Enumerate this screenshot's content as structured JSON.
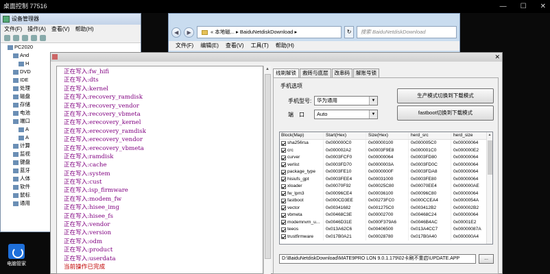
{
  "remote": {
    "title": "桌面控制 77516",
    "controls": [
      "—",
      "☐",
      "✕"
    ]
  },
  "desktop": {
    "icon_label": "电脑管家"
  },
  "devmgr": {
    "title": "设备管理器",
    "menu": [
      "文件(F)",
      "操作(A)",
      "查看(V)",
      "帮助(H)"
    ],
    "tree": [
      "PC2020",
      "And",
      "H",
      "DVD",
      "IDE",
      "处理",
      "磁盘",
      "存储",
      "电池",
      "端口",
      "计算",
      "监视",
      "键盘",
      "蓝牙",
      "人体",
      "软件",
      "鼠标",
      "通用"
    ]
  },
  "explorer": {
    "address": "« 本地磁...  ▸  BaiduNetdiskDownload  ▸",
    "search_placeholder": "搜索 BaiduNetdiskDownload",
    "menu": [
      "文件(F)",
      "编辑(E)",
      "查看(V)",
      "工具(T)",
      "帮助(H)"
    ]
  },
  "tool": {
    "log": [
      "正在写入:fw_hifi",
      "正在写入:dts",
      "正在写入:kernel",
      "正在写入:recovery_ramdisk",
      "正在写入:recovery_vendor",
      "正在写入:recovery_vbmeta",
      "正在写入:erecovery_kernel",
      "正在写入:erecovery_ramdisk",
      "正在写入:erecovery_vendor",
      "正在写入:erecovery_vbmeta",
      "正在写入:ramdisk",
      "正在写入:cache",
      "正在写入:system",
      "正在写入:cust",
      "正在写入:isp_firmware",
      "正在写入:modem_fw",
      "正在写入:hisee_img",
      "正在写入:hisee_fs",
      "正在写入:vendor",
      "正在写入:version",
      "正在写入:odm",
      "正在写入:product",
      "正在写入:userdata"
    ],
    "log_done": "当前操作已完成",
    "tabs": [
      "线刷解锁",
      "救砖与底层",
      "改串码",
      "解账号锁"
    ],
    "group_label": "手机选项",
    "model_label": "手机型号:",
    "model_value": "华为通用",
    "port_label": "端　口",
    "port_value": "Auto",
    "btn_prod": "生产模式切换到下载模式",
    "btn_fastboot": "fastboot切换到下载模式",
    "columns": [
      "Block(Map)",
      "Start(Hex)",
      "Size(Hex)",
      "herd_src",
      "herd_size"
    ],
    "rows": [
      [
        "sha256rsa",
        "0x000000C0",
        "0x00000100",
        "0x000005C0",
        "0x00000064"
      ],
      [
        "crc",
        "0x000002A2",
        "0x0003F9E8",
        "0x000001C0",
        "0x000000E2"
      ],
      [
        "curver",
        "0x0003FCF0",
        "0x00000064",
        "0x0003FD80",
        "0x00000064"
      ],
      [
        "verlist",
        "0x0003FD70",
        "0x0000003A",
        "0x0003FD0C",
        "0x00000064"
      ],
      [
        "package_type",
        "0x0003FE10",
        "0x0000000F",
        "0x0003FDA8",
        "0x00000064"
      ],
      [
        "hisiufs_gpt",
        "0x0003FEE4",
        "0x00031000",
        "0x0003FE80",
        "0x00000064"
      ],
      [
        "xloader",
        "0x00070F92",
        "0x00025C80",
        "0x00070EE4",
        "0x000000AE"
      ],
      [
        "fw_lpm3",
        "0x00096CE4",
        "0x00036100",
        "0x00096C80",
        "0x00000064"
      ],
      [
        "fastboot",
        "0x000CD3EE",
        "0x00273FC0",
        "0x000CCEA4",
        "0x0000054A"
      ],
      [
        "vector",
        "0x00341682",
        "0x001275C0",
        "0x003412B2",
        "0x000002B2"
      ],
      [
        "vbmeta",
        "0x00468C3E",
        "0x00002700",
        "0x00468C24",
        "0x00000064"
      ],
      [
        "modemnvm_u...",
        "0x0046D31E",
        "0x000F379A6",
        "0x0046B4AC",
        "0x00001E2"
      ],
      [
        "teeos",
        "0x013A62C6",
        "0x00406500",
        "0x013A4CC7",
        "0x00000087A"
      ],
      [
        "trustfirmware",
        "0x017B0A21",
        "0x00028780",
        "0x017B0A40",
        "0x000000A4"
      ]
    ],
    "path": "D:\\BaiduNetdiskDownload\\MATE9PRO  LON 9.0.1.179\\02卡刷不重启\\UPDATE.APP",
    "browse": "..."
  }
}
